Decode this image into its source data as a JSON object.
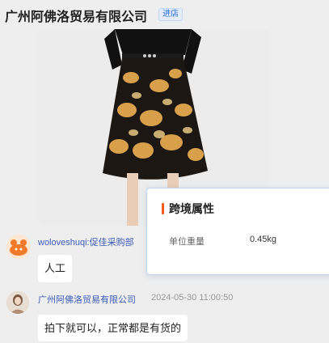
{
  "header": {
    "title": "广州阿佛洛贸易有限公司",
    "badge": "进店"
  },
  "messages": [
    {
      "sender": "woloveshuqi:促佳采购部",
      "text": "人工"
    },
    {
      "sender": "广州阿佛洛贸易有限公司",
      "time": "2024-05-30 11:00:50",
      "text": "拍下就可以，正常都是有货的"
    }
  ],
  "popup": {
    "title": "跨境属性",
    "key": "单位重量",
    "value": "0.45kg"
  },
  "colors": {
    "accent": "#f25b1a",
    "link": "#3b5cb8",
    "badge": "#2a6fd6"
  }
}
